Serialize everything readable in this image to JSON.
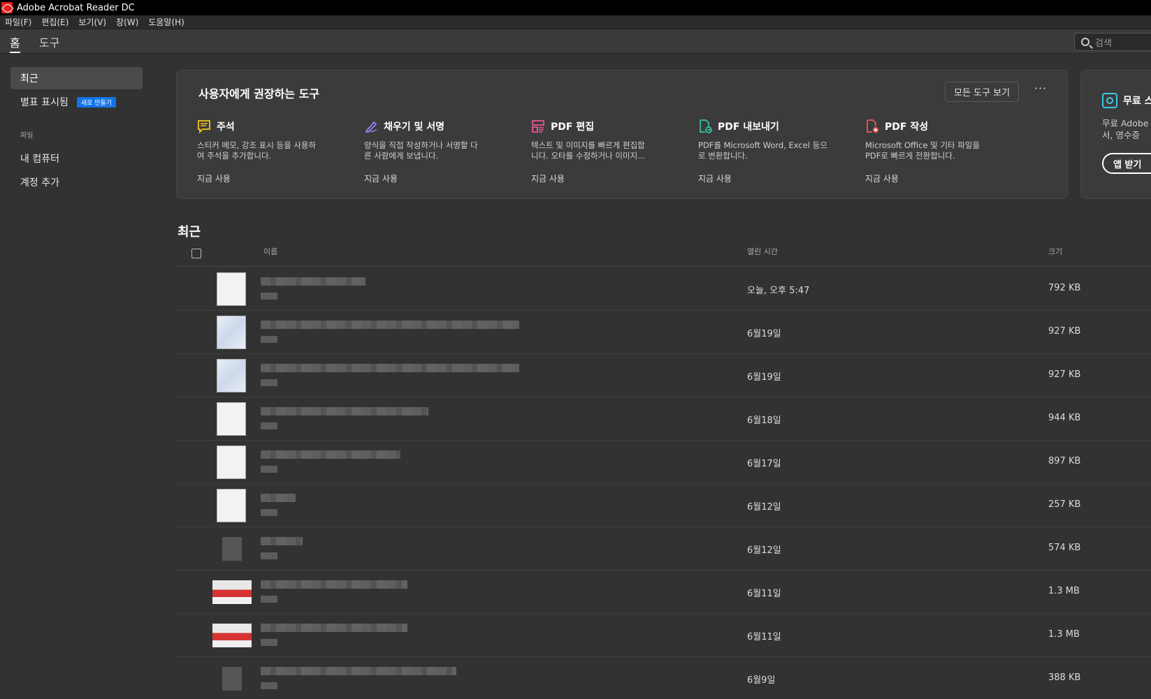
{
  "window": {
    "title": "Adobe Acrobat Reader DC"
  },
  "menubar": {
    "items": [
      "파일(F)",
      "편집(E)",
      "보기(V)",
      "창(W)",
      "도움말(H)"
    ]
  },
  "tabs": {
    "home": "홈",
    "tools": "도구",
    "active": "home"
  },
  "search": {
    "placeholder": "검색",
    "icon": "search-icon"
  },
  "sidebar": {
    "recent": "최근",
    "starred": "별표 표시됨",
    "starred_badge": "새로 만들기",
    "files_section": "파일",
    "my_computer": "내 컴퓨터",
    "add_account": "계정 추가"
  },
  "tools_card": {
    "heading": "사용자에게 권장하는 도구",
    "all_tools_button": "모든 도구 보기",
    "more": "···",
    "tools": [
      {
        "name": "주석",
        "icon": "comment-icon",
        "color": "#f5c518",
        "desc_line1": "스티커 메모, 강조 표시 등을 사용하",
        "desc_line2": "여 주석을 추가합니다.",
        "action": "지금 사용"
      },
      {
        "name": "채우기 및 서명",
        "icon": "fill-sign-icon",
        "color": "#9b7ff5",
        "desc_line1": "양식을 직접 작성하거나 서명할 다",
        "desc_line2": "른 사람에게 보냅니다.",
        "action": "지금 사용"
      },
      {
        "name": "PDF 편집",
        "icon": "edit-pdf-icon",
        "color": "#f0569b",
        "desc_line1": "텍스트 및 이미지를 빠르게 편집합",
        "desc_line2": "니다. 오타를 수정하거나 이미지...",
        "action": "지금 사용"
      },
      {
        "name": "PDF 내보내기",
        "icon": "export-pdf-icon",
        "color": "#34c6a6",
        "desc_line1": "PDF를 Microsoft Word, Excel 등으",
        "desc_line2": "로 변환합니다.",
        "action": "지금 사용"
      },
      {
        "name": "PDF 작성",
        "icon": "create-pdf-icon",
        "color": "#f05a5a",
        "desc_line1": "Microsoft Office 및 기타 파일을",
        "desc_line2": "PDF로 빠르게 전환합니다.",
        "action": "지금 사용"
      }
    ]
  },
  "promo_card": {
    "title": "무료 스",
    "desc_line1": "무료 Adobe",
    "desc_line2": "서, 영수증 ",
    "button": "앱 받기"
  },
  "recent": {
    "title": "최근",
    "columns": {
      "name": "이름",
      "opened": "열린 시간",
      "size": "크기"
    },
    "files": [
      {
        "opened": "오늘, 오후 5:47",
        "size": "792 KB",
        "thumb": "doc"
      },
      {
        "opened": "6월19일",
        "size": "927 KB",
        "thumb": "doc-blue"
      },
      {
        "opened": "6월19일",
        "size": "927 KB",
        "thumb": "doc-blue"
      },
      {
        "opened": "6월18일",
        "size": "944 KB",
        "thumb": "doc"
      },
      {
        "opened": "6월17일",
        "size": "897 KB",
        "thumb": "doc"
      },
      {
        "opened": "6월12일",
        "size": "257 KB",
        "thumb": "doc"
      },
      {
        "opened": "6월12일",
        "size": "574 KB",
        "thumb": "gray"
      },
      {
        "opened": "6월11일",
        "size": "1.3 MB",
        "thumb": "red"
      },
      {
        "opened": "6월11일",
        "size": "1.3 MB",
        "thumb": "red"
      },
      {
        "opened": "6월9일",
        "size": "388 KB",
        "thumb": "gray"
      }
    ]
  }
}
